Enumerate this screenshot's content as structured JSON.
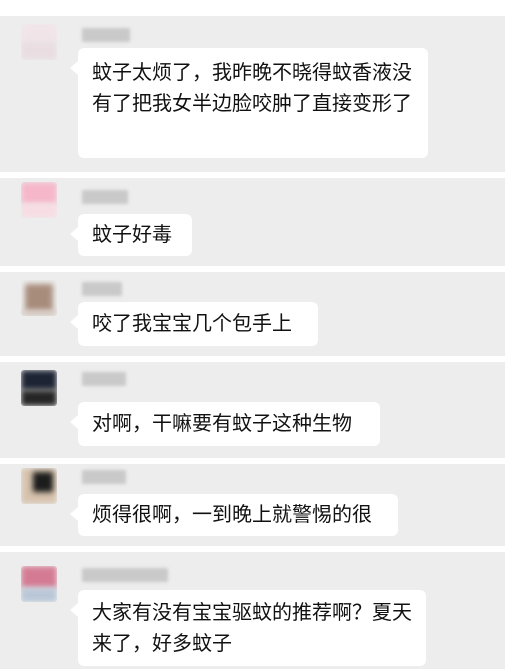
{
  "comments": [
    {
      "avatar_colors": [
        "#f1e4e8",
        "#e9dde2"
      ],
      "text": "蚊子太烦了，我昨晚不晓得蚊香液没有了把我女半边脸咬肿了直接变形了"
    },
    {
      "avatar_colors": [
        "#f5b7c9",
        "#f7dce4"
      ],
      "text": "蚊子好毒"
    },
    {
      "avatar_colors": [
        "#a88c7b",
        "#d7cbc4"
      ],
      "text": "咬了我宝宝几个包手上"
    },
    {
      "avatar_colors": [
        "#1d2433",
        "#252525"
      ],
      "text": "对啊，干嘛要有蚊子这种生物"
    },
    {
      "avatar_colors": [
        "#d6c2ad",
        "#1c1c1c"
      ],
      "text": "烦得很啊，一到晚上就警惕的很"
    },
    {
      "avatar_colors": [
        "#d47b93",
        "#b8c6d6"
      ],
      "text": "大家有没有宝宝驱蚊的推荐啊？夏天来了，好多蚊子"
    }
  ]
}
